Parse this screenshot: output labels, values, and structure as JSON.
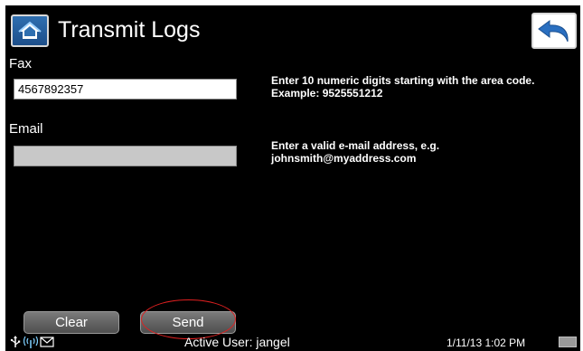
{
  "header": {
    "title": "Transmit Logs",
    "home_icon": "home-icon",
    "back_icon": "back-arrow-icon"
  },
  "fax": {
    "label": "Fax",
    "value": "4567892357",
    "help": "Enter 10 numeric digits starting with the area code. Example: 9525551212"
  },
  "email": {
    "label": "Email",
    "value": "",
    "help": "Enter a valid e-mail address, e.g. johnsmith@myaddress.com"
  },
  "buttons": {
    "clear": "Clear",
    "send": "Send"
  },
  "status_bar": {
    "icons": [
      "usb-icon",
      "wireless-signal-icon",
      "mail-icon"
    ],
    "active_user": "Active User: jangel",
    "datetime": "1/11/13 1:02 PM",
    "keyboard_icon": "keyboard-icon"
  },
  "colors": {
    "background": "#000000",
    "text": "#ffffff",
    "button_gray": "#6a6a6a",
    "accent_blue": "#1f5fa8",
    "highlight_red": "#e02020"
  }
}
